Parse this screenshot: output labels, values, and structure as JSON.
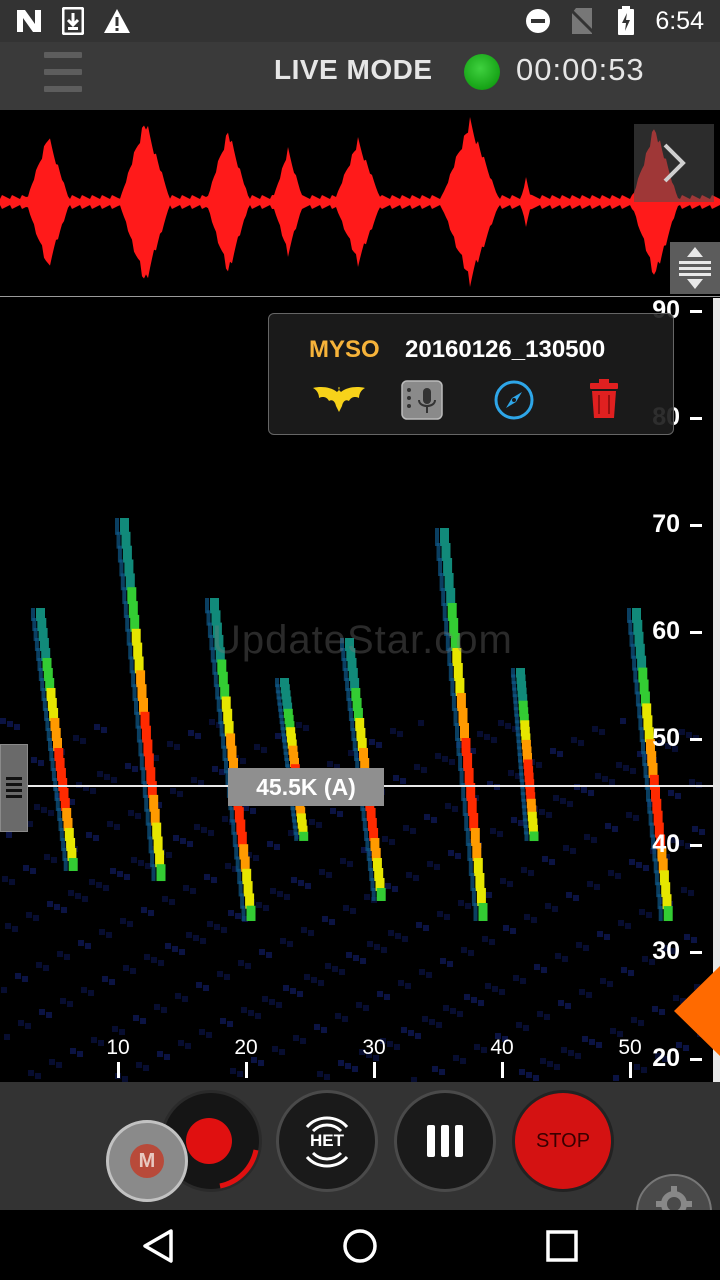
{
  "status_bar": {
    "time": "6:54",
    "left_icons": [
      "n-logo-icon",
      "download-icon",
      "warning-icon"
    ],
    "right_icons": [
      "do-not-disturb-icon",
      "no-sim-icon",
      "battery-charging-icon"
    ]
  },
  "header": {
    "menu_icon": "menu-icon",
    "mode_label": "LIVE MODE",
    "status_color": "#22bb22",
    "timer": "00:00:53"
  },
  "recording_info": {
    "species": "MYSO",
    "filename": "20160126_130500",
    "species_color": "#f6b33a",
    "icons": [
      "bat-icon",
      "recorder-mic-icon",
      "compass-icon",
      "trash-icon"
    ]
  },
  "spectrogram": {
    "freq_axis_labels": [
      "90",
      "80",
      "70",
      "60",
      "50",
      "40",
      "30",
      "20"
    ],
    "time_axis_labels": [
      "10",
      "20",
      "30",
      "40",
      "50"
    ],
    "cursor_label": "45.5K (A)",
    "watermark": "UpdateStar.com"
  },
  "controls": {
    "marker_label": "M",
    "het_label": "HET",
    "stop_label": "STOP",
    "record_color": "#e01010"
  }
}
